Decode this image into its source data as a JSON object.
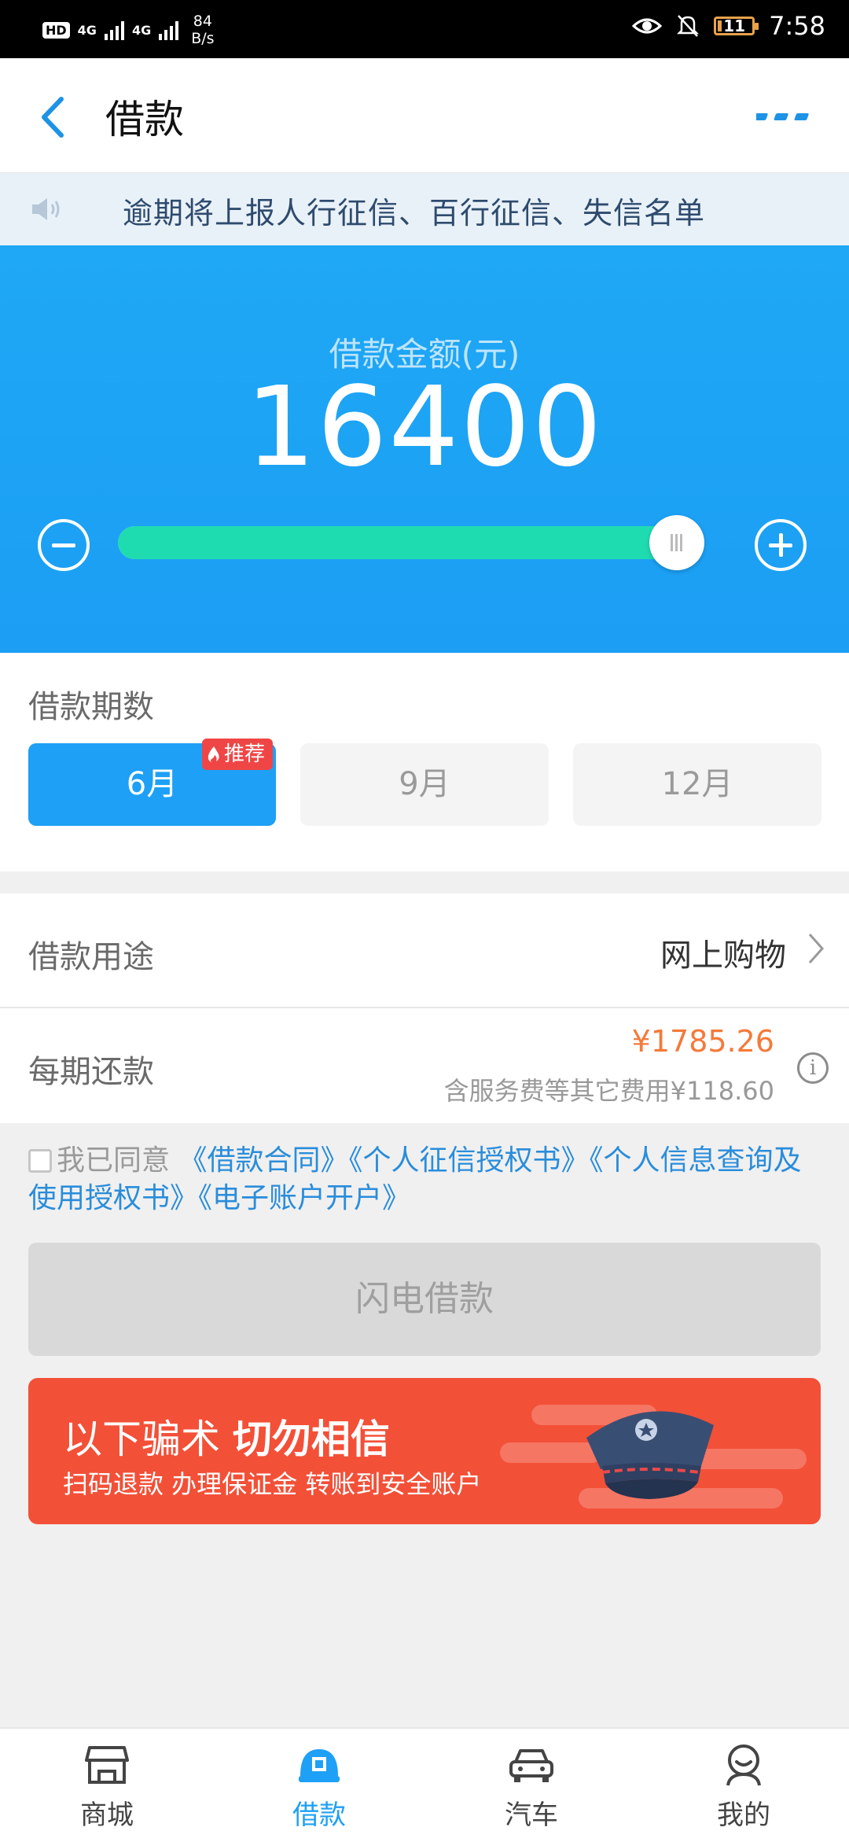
{
  "status_bar": {
    "hd": "HD",
    "net1": "4G",
    "net2": "4G",
    "speed_value": "84",
    "speed_unit": "B/s",
    "battery": "11",
    "time": "7:58"
  },
  "header": {
    "title": "借款"
  },
  "notice": {
    "text": "逾期将上报人行征信、百行征信、失信名单"
  },
  "loan": {
    "amount_label": "借款金额(元)",
    "amount": "16400",
    "slider_fraction": 1.0
  },
  "periods": {
    "label": "借款期数",
    "options": [
      "6月",
      "9月",
      "12月"
    ],
    "selected": "6月",
    "recommend_badge": "推荐"
  },
  "purpose": {
    "label": "借款用途",
    "value": "网上购物"
  },
  "repayment": {
    "label": "每期还款",
    "amount": "¥1785.26",
    "fee_note": "含服务费等其它费用¥118.60"
  },
  "agreement": {
    "prefix": "我已同意",
    "links": [
      "《借款合同》",
      "《个人征信授权书》",
      "《个人信息查询及使用授权书》",
      "《电子账户开户》"
    ]
  },
  "submit": {
    "label": "闪电借款"
  },
  "warning": {
    "line1_a": "以下骗术 ",
    "line1_b": "切勿相信",
    "line2": "扫码退款 办理保证金 转账到安全账户"
  },
  "tabs": [
    {
      "label": "商城",
      "icon": "store-icon",
      "active": false
    },
    {
      "label": "借款",
      "icon": "loan-icon",
      "active": true
    },
    {
      "label": "汽车",
      "icon": "car-icon",
      "active": false
    },
    {
      "label": "我的",
      "icon": "profile-icon",
      "active": false
    }
  ],
  "colors": {
    "primary": "#1ea0f6",
    "slider_fill": "#1fdcb0",
    "repay_amount": "#f47a3a",
    "warning_bg": "#f35038",
    "badge": "#f04545"
  }
}
